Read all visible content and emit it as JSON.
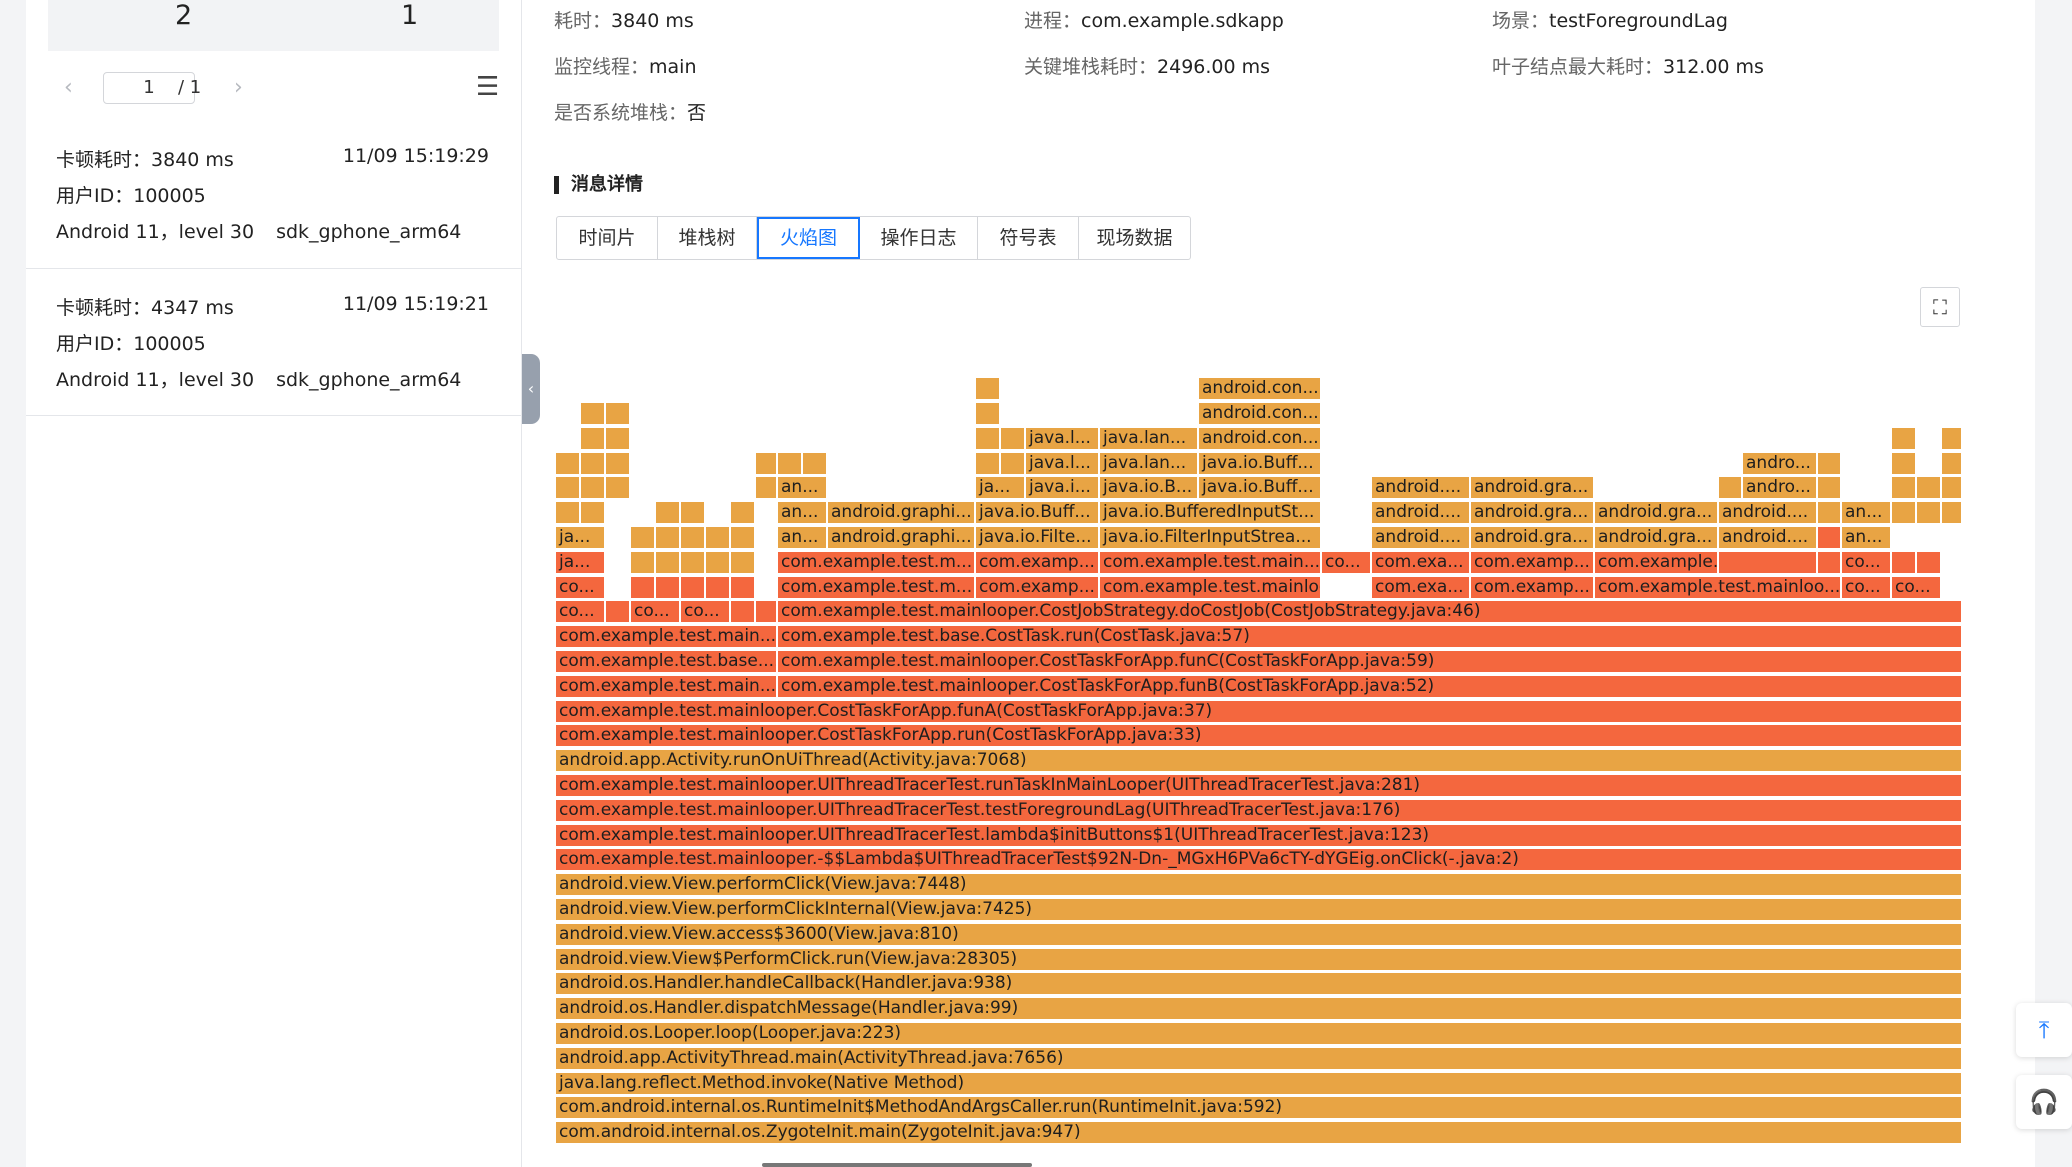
{
  "left_panel": {
    "stats": [
      "2",
      "1"
    ],
    "pager": {
      "prev": "‹",
      "current": "1",
      "total": "/ 1",
      "next": "›",
      "menu": "☰"
    },
    "cards": [
      {
        "lag_label": "卡顿耗时：",
        "lag_value": "3840 ms",
        "time": "11/09 15:19:29",
        "user_label": "用户ID：",
        "user_value": "100005",
        "os": "Android 11，level 30",
        "device": "sdk_gphone_arm64"
      },
      {
        "lag_label": "卡顿耗时：",
        "lag_value": "4347 ms",
        "time": "11/09 15:19:21",
        "user_label": "用户ID：",
        "user_value": "100005",
        "os": "Android 11，level 30",
        "device": "sdk_gphone_arm64"
      }
    ]
  },
  "collapse_handle": "‹",
  "summary": {
    "duration": {
      "label": "耗时：",
      "value": "3840 ms"
    },
    "process": {
      "label": "进程：",
      "value": "com.example.sdkapp"
    },
    "scene": {
      "label": "场景：",
      "value": "testForegroundLag"
    },
    "thread": {
      "label": "监控线程：",
      "value": "main"
    },
    "key_stack": {
      "label": "关键堆栈耗时：",
      "value": "2496.00 ms"
    },
    "leaf_max": {
      "label": "叶子结点最大耗时：",
      "value": "312.00 ms"
    },
    "system_stack": {
      "label": "是否系统堆栈：",
      "value": "否"
    }
  },
  "section_title": "消息详情",
  "tabs": [
    {
      "label": "时间片",
      "active": false
    },
    {
      "label": "堆栈树",
      "active": false
    },
    {
      "label": "火焰图",
      "active": true
    },
    {
      "label": "操作日志",
      "active": false
    },
    {
      "label": "符号表",
      "active": false
    },
    {
      "label": "现场数据",
      "active": false
    }
  ],
  "expand_icon": "⛶",
  "colors": {
    "frame_orange": "#e8a444",
    "frame_red": "#f4673e",
    "accent": "#1677ff"
  },
  "float_buttons": [
    "⤒",
    "🎧"
  ],
  "flame_frames": [
    {
      "text": "com.android.internal.os.ZygoteInit.main(ZygoteInit.java:947)",
      "c": "o",
      "l": 0,
      "w": 1407,
      "d": 0
    },
    {
      "text": "com.android.internal.os.RuntimeInit$MethodAndArgsCaller.run(RuntimeInit.java:592)",
      "c": "o",
      "l": 0,
      "w": 1407,
      "d": 1
    },
    {
      "text": "java.lang.reflect.Method.invoke(Native Method)",
      "c": "o",
      "l": 0,
      "w": 1407,
      "d": 2
    },
    {
      "text": "android.app.ActivityThread.main(ActivityThread.java:7656)",
      "c": "o",
      "l": 0,
      "w": 1407,
      "d": 3
    },
    {
      "text": "android.os.Looper.loop(Looper.java:223)",
      "c": "o",
      "l": 0,
      "w": 1407,
      "d": 4
    },
    {
      "text": "android.os.Handler.dispatchMessage(Handler.java:99)",
      "c": "o",
      "l": 0,
      "w": 1407,
      "d": 5
    },
    {
      "text": "android.os.Handler.handleCallback(Handler.java:938)",
      "c": "o",
      "l": 0,
      "w": 1407,
      "d": 6
    },
    {
      "text": "android.view.View$PerformClick.run(View.java:28305)",
      "c": "o",
      "l": 0,
      "w": 1407,
      "d": 7
    },
    {
      "text": "android.view.View.access$3600(View.java:810)",
      "c": "o",
      "l": 0,
      "w": 1407,
      "d": 8
    },
    {
      "text": "android.view.View.performClickInternal(View.java:7425)",
      "c": "o",
      "l": 0,
      "w": 1407,
      "d": 9
    },
    {
      "text": "android.view.View.performClick(View.java:7448)",
      "c": "o",
      "l": 0,
      "w": 1407,
      "d": 10
    },
    {
      "text": "com.example.test.mainlooper.-$$Lambda$UIThreadTracerTest$92N-Dn-_MGxH6PVa6cTY-dYGEig.onClick(-.java:2)",
      "c": "r",
      "l": 0,
      "w": 1407,
      "d": 11
    },
    {
      "text": "com.example.test.mainlooper.UIThreadTracerTest.lambda$initButtons$1(UIThreadTracerTest.java:123)",
      "c": "r",
      "l": 0,
      "w": 1407,
      "d": 12
    },
    {
      "text": "com.example.test.mainlooper.UIThreadTracerTest.testForegroundLag(UIThreadTracerTest.java:176)",
      "c": "r",
      "l": 0,
      "w": 1407,
      "d": 13
    },
    {
      "text": "com.example.test.mainlooper.UIThreadTracerTest.runTaskInMainLooper(UIThreadTracerTest.java:281)",
      "c": "r",
      "l": 0,
      "w": 1407,
      "d": 14
    },
    {
      "text": "android.app.Activity.runOnUiThread(Activity.java:7068)",
      "c": "o",
      "l": 0,
      "w": 1407,
      "d": 15
    },
    {
      "text": "com.example.test.mainlooper.CostTaskForApp.run(CostTaskForApp.java:33)",
      "c": "r",
      "l": 0,
      "w": 1407,
      "d": 16
    },
    {
      "text": "com.example.test.mainlooper.CostTaskForApp.funA(CostTaskForApp.java:37)",
      "c": "r",
      "l": 0,
      "w": 1407,
      "d": 17
    },
    {
      "text": "com.example.test.main...",
      "c": "r",
      "l": 0,
      "w": 222,
      "d": 18
    },
    {
      "text": "com.example.test.mainlooper.CostTaskForApp.funB(CostTaskForApp.java:52)",
      "c": "r",
      "l": 222,
      "w": 1185,
      "d": 18
    },
    {
      "text": "com.example.test.base....",
      "c": "r",
      "l": 0,
      "w": 222,
      "d": 19
    },
    {
      "text": "com.example.test.mainlooper.CostTaskForApp.funC(CostTaskForApp.java:59)",
      "c": "r",
      "l": 222,
      "w": 1185,
      "d": 19
    },
    {
      "text": "com.example.test.main...",
      "c": "r",
      "l": 0,
      "w": 222,
      "d": 20
    },
    {
      "text": "com.example.test.base.CostTask.run(CostTask.java:57)",
      "c": "r",
      "l": 222,
      "w": 1185,
      "d": 20
    },
    {
      "text": "co...",
      "c": "r",
      "l": 0,
      "w": 50,
      "d": 21
    },
    {
      "text": "",
      "c": "r",
      "l": 50,
      "w": 25,
      "d": 21
    },
    {
      "text": "co...",
      "c": "r",
      "l": 75,
      "w": 50,
      "d": 21
    },
    {
      "text": "co...",
      "c": "r",
      "l": 125,
      "w": 50,
      "d": 21
    },
    {
      "text": "",
      "c": "r",
      "l": 175,
      "w": 25,
      "d": 21
    },
    {
      "text": "",
      "c": "r",
      "l": 200,
      "w": 22,
      "d": 21
    },
    {
      "text": "com.example.test.mainlooper.CostJobStrategy.doCostJob(CostJobStrategy.java:46)",
      "c": "r",
      "l": 222,
      "w": 1185,
      "d": 21
    },
    {
      "text": "co...",
      "c": "r",
      "l": 0,
      "w": 50,
      "d": 22
    },
    {
      "text": "",
      "c": "r",
      "l": 75,
      "w": 25,
      "d": 22
    },
    {
      "text": "",
      "c": "r",
      "l": 100,
      "w": 25,
      "d": 22
    },
    {
      "text": "",
      "c": "r",
      "l": 125,
      "w": 25,
      "d": 22
    },
    {
      "text": "",
      "c": "r",
      "l": 150,
      "w": 25,
      "d": 22
    },
    {
      "text": "",
      "c": "r",
      "l": 175,
      "w": 25,
      "d": 22
    },
    {
      "text": "com.example.test.m...",
      "c": "r",
      "l": 222,
      "w": 198,
      "d": 22
    },
    {
      "text": "com.examp...",
      "c": "r",
      "l": 420,
      "w": 124,
      "d": 22
    },
    {
      "text": "com.example.test.mainlooper...",
      "c": "r",
      "l": 544,
      "w": 222,
      "d": 22
    },
    {
      "text": "com.exa...",
      "c": "r",
      "l": 816,
      "w": 99,
      "d": 22
    },
    {
      "text": "com.examp...",
      "c": "r",
      "l": 915,
      "w": 124,
      "d": 22
    },
    {
      "text": "com.example.test.mainloo...",
      "c": "r",
      "l": 1039,
      "w": 247,
      "d": 22
    },
    {
      "text": "co...",
      "c": "r",
      "l": 1286,
      "w": 50,
      "d": 22
    },
    {
      "text": "co...",
      "c": "r",
      "l": 1336,
      "w": 50,
      "d": 22
    },
    {
      "text": "ja...",
      "c": "r",
      "l": 0,
      "w": 50,
      "d": 23
    },
    {
      "text": "",
      "c": "o",
      "l": 75,
      "w": 25,
      "d": 23
    },
    {
      "text": "",
      "c": "o",
      "l": 100,
      "w": 25,
      "d": 23
    },
    {
      "text": "",
      "c": "o",
      "l": 125,
      "w": 25,
      "d": 23
    },
    {
      "text": "",
      "c": "o",
      "l": 150,
      "w": 25,
      "d": 23
    },
    {
      "text": "",
      "c": "o",
      "l": 175,
      "w": 25,
      "d": 23
    },
    {
      "text": "com.example.test.m...",
      "c": "r",
      "l": 222,
      "w": 198,
      "d": 23
    },
    {
      "text": "com.examp...",
      "c": "r",
      "l": 420,
      "w": 124,
      "d": 23
    },
    {
      "text": "com.example.test.main...",
      "c": "r",
      "l": 544,
      "w": 222,
      "d": 23
    },
    {
      "text": "co...",
      "c": "r",
      "l": 766,
      "w": 50,
      "d": 23
    },
    {
      "text": "com.exa...",
      "c": "r",
      "l": 816,
      "w": 99,
      "d": 23
    },
    {
      "text": "com.examp...",
      "c": "r",
      "l": 915,
      "w": 124,
      "d": 23
    },
    {
      "text": "com.example.test.main...",
      "c": "r",
      "l": 1039,
      "w": 124,
      "d": 23
    },
    {
      "text": "",
      "c": "r",
      "l": 1163,
      "w": 99,
      "d": 23
    },
    {
      "text": "",
      "c": "r",
      "l": 1262,
      "w": 24,
      "d": 23
    },
    {
      "text": "co...",
      "c": "r",
      "l": 1286,
      "w": 50,
      "d": 23
    },
    {
      "text": "",
      "c": "r",
      "l": 1336,
      "w": 25,
      "d": 23
    },
    {
      "text": "",
      "c": "r",
      "l": 1361,
      "w": 25,
      "d": 23
    },
    {
      "text": "ja...",
      "c": "o",
      "l": 0,
      "w": 50,
      "d": 24
    },
    {
      "text": "",
      "c": "o",
      "l": 75,
      "w": 25,
      "d": 24
    },
    {
      "text": "",
      "c": "o",
      "l": 100,
      "w": 25,
      "d": 24
    },
    {
      "text": "",
      "c": "o",
      "l": 125,
      "w": 25,
      "d": 24
    },
    {
      "text": "",
      "c": "o",
      "l": 150,
      "w": 25,
      "d": 24
    },
    {
      "text": "",
      "c": "o",
      "l": 175,
      "w": 25,
      "d": 24
    },
    {
      "text": "an...",
      "c": "o",
      "l": 222,
      "w": 50,
      "d": 24
    },
    {
      "text": "android.graphi...",
      "c": "o",
      "l": 272,
      "w": 148,
      "d": 24
    },
    {
      "text": "java.io.Filte...",
      "c": "o",
      "l": 420,
      "w": 124,
      "d": 24
    },
    {
      "text": "java.io.FilterInputStrea...",
      "c": "o",
      "l": 544,
      "w": 222,
      "d": 24
    },
    {
      "text": "android....",
      "c": "o",
      "l": 816,
      "w": 99,
      "d": 24
    },
    {
      "text": "android.gra...",
      "c": "o",
      "l": 915,
      "w": 124,
      "d": 24
    },
    {
      "text": "android.gra...",
      "c": "o",
      "l": 1039,
      "w": 124,
      "d": 24
    },
    {
      "text": "android....",
      "c": "o",
      "l": 1163,
      "w": 99,
      "d": 24
    },
    {
      "text": "",
      "c": "r",
      "l": 1262,
      "w": 24,
      "d": 24
    },
    {
      "text": "an...",
      "c": "o",
      "l": 1286,
      "w": 50,
      "d": 24
    },
    {
      "text": "",
      "c": "o",
      "l": 0,
      "w": 25,
      "d": 25
    },
    {
      "text": "",
      "c": "o",
      "l": 25,
      "w": 25,
      "d": 25
    },
    {
      "text": "",
      "c": "o",
      "l": 100,
      "w": 25,
      "d": 25
    },
    {
      "text": "",
      "c": "o",
      "l": 125,
      "w": 25,
      "d": 25
    },
    {
      "text": "",
      "c": "o",
      "l": 175,
      "w": 25,
      "d": 25
    },
    {
      "text": "an...",
      "c": "o",
      "l": 222,
      "w": 50,
      "d": 25
    },
    {
      "text": "android.graphi...",
      "c": "o",
      "l": 272,
      "w": 148,
      "d": 25
    },
    {
      "text": "java.io.Buff...",
      "c": "o",
      "l": 420,
      "w": 124,
      "d": 25
    },
    {
      "text": "java.io.BufferedInputSt...",
      "c": "o",
      "l": 544,
      "w": 222,
      "d": 25
    },
    {
      "text": "android....",
      "c": "o",
      "l": 816,
      "w": 99,
      "d": 25
    },
    {
      "text": "android.gra...",
      "c": "o",
      "l": 915,
      "w": 124,
      "d": 25
    },
    {
      "text": "android.gra...",
      "c": "o",
      "l": 1039,
      "w": 124,
      "d": 25
    },
    {
      "text": "android....",
      "c": "o",
      "l": 1163,
      "w": 99,
      "d": 25
    },
    {
      "text": "",
      "c": "o",
      "l": 1262,
      "w": 24,
      "d": 25
    },
    {
      "text": "an...",
      "c": "o",
      "l": 1286,
      "w": 50,
      "d": 25
    },
    {
      "text": "",
      "c": "o",
      "l": 1336,
      "w": 25,
      "d": 25
    },
    {
      "text": "",
      "c": "o",
      "l": 1361,
      "w": 25,
      "d": 25
    },
    {
      "text": "",
      "c": "o",
      "l": 1386,
      "w": 21,
      "d": 25
    },
    {
      "text": "",
      "c": "o",
      "l": 0,
      "w": 25,
      "d": 26
    },
    {
      "text": "",
      "c": "o",
      "l": 25,
      "w": 25,
      "d": 26
    },
    {
      "text": "",
      "c": "o",
      "l": 50,
      "w": 25,
      "d": 26
    },
    {
      "text": "",
      "c": "o",
      "l": 200,
      "w": 22,
      "d": 26
    },
    {
      "text": "an...",
      "c": "o",
      "l": 222,
      "w": 50,
      "d": 26
    },
    {
      "text": "ja...",
      "c": "o",
      "l": 420,
      "w": 50,
      "d": 26
    },
    {
      "text": "java.i...",
      "c": "o",
      "l": 470,
      "w": 74,
      "d": 26
    },
    {
      "text": "java.io.B...",
      "c": "o",
      "l": 544,
      "w": 99,
      "d": 26
    },
    {
      "text": "java.io.Buff...",
      "c": "o",
      "l": 643,
      "w": 123,
      "d": 26
    },
    {
      "text": "android....",
      "c": "o",
      "l": 816,
      "w": 99,
      "d": 26
    },
    {
      "text": "android.gra...",
      "c": "o",
      "l": 915,
      "w": 124,
      "d": 26
    },
    {
      "text": "",
      "c": "o",
      "l": 1163,
      "w": 24,
      "d": 26
    },
    {
      "text": "andro...",
      "c": "o",
      "l": 1187,
      "w": 75,
      "d": 26
    },
    {
      "text": "",
      "c": "o",
      "l": 1262,
      "w": 24,
      "d": 26
    },
    {
      "text": "",
      "c": "o",
      "l": 1336,
      "w": 25,
      "d": 26
    },
    {
      "text": "",
      "c": "o",
      "l": 1361,
      "w": 25,
      "d": 26
    },
    {
      "text": "",
      "c": "o",
      "l": 1386,
      "w": 21,
      "d": 26
    },
    {
      "text": "",
      "c": "o",
      "l": 0,
      "w": 25,
      "d": 27
    },
    {
      "text": "",
      "c": "o",
      "l": 25,
      "w": 25,
      "d": 27
    },
    {
      "text": "",
      "c": "o",
      "l": 50,
      "w": 25,
      "d": 27
    },
    {
      "text": "",
      "c": "o",
      "l": 200,
      "w": 22,
      "d": 27
    },
    {
      "text": "",
      "c": "o",
      "l": 222,
      "w": 25,
      "d": 27
    },
    {
      "text": "",
      "c": "o",
      "l": 247,
      "w": 25,
      "d": 27
    },
    {
      "text": "",
      "c": "o",
      "l": 420,
      "w": 25,
      "d": 27
    },
    {
      "text": "",
      "c": "o",
      "l": 445,
      "w": 25,
      "d": 27
    },
    {
      "text": "java.l...",
      "c": "o",
      "l": 470,
      "w": 74,
      "d": 27
    },
    {
      "text": "java.lan...",
      "c": "o",
      "l": 544,
      "w": 99,
      "d": 27
    },
    {
      "text": "java.io.Buff...",
      "c": "o",
      "l": 643,
      "w": 123,
      "d": 27
    },
    {
      "text": "andro...",
      "c": "o",
      "l": 1187,
      "w": 75,
      "d": 27
    },
    {
      "text": "",
      "c": "o",
      "l": 1262,
      "w": 24,
      "d": 27
    },
    {
      "text": "",
      "c": "o",
      "l": 1336,
      "w": 25,
      "d": 27
    },
    {
      "text": "",
      "c": "o",
      "l": 1386,
      "w": 21,
      "d": 27
    },
    {
      "text": "",
      "c": "o",
      "l": 25,
      "w": 25,
      "d": 28
    },
    {
      "text": "",
      "c": "o",
      "l": 50,
      "w": 25,
      "d": 28
    },
    {
      "text": "",
      "c": "o",
      "l": 420,
      "w": 25,
      "d": 28
    },
    {
      "text": "",
      "c": "o",
      "l": 445,
      "w": 25,
      "d": 28
    },
    {
      "text": "java.l...",
      "c": "o",
      "l": 470,
      "w": 74,
      "d": 28
    },
    {
      "text": "java.lan...",
      "c": "o",
      "l": 544,
      "w": 99,
      "d": 28
    },
    {
      "text": "android.con...",
      "c": "o",
      "l": 643,
      "w": 123,
      "d": 28
    },
    {
      "text": "",
      "c": "o",
      "l": 1336,
      "w": 25,
      "d": 28
    },
    {
      "text": "",
      "c": "o",
      "l": 1386,
      "w": 21,
      "d": 28
    },
    {
      "text": "",
      "c": "o",
      "l": 25,
      "w": 25,
      "d": 29
    },
    {
      "text": "",
      "c": "o",
      "l": 50,
      "w": 25,
      "d": 29
    },
    {
      "text": "",
      "c": "o",
      "l": 420,
      "w": 25,
      "d": 29
    },
    {
      "text": "android.con...",
      "c": "o",
      "l": 643,
      "w": 123,
      "d": 29
    },
    {
      "text": "",
      "c": "o",
      "l": 420,
      "w": 25,
      "d": 30
    },
    {
      "text": "android.con...",
      "c": "o",
      "l": 643,
      "w": 123,
      "d": 30
    }
  ]
}
